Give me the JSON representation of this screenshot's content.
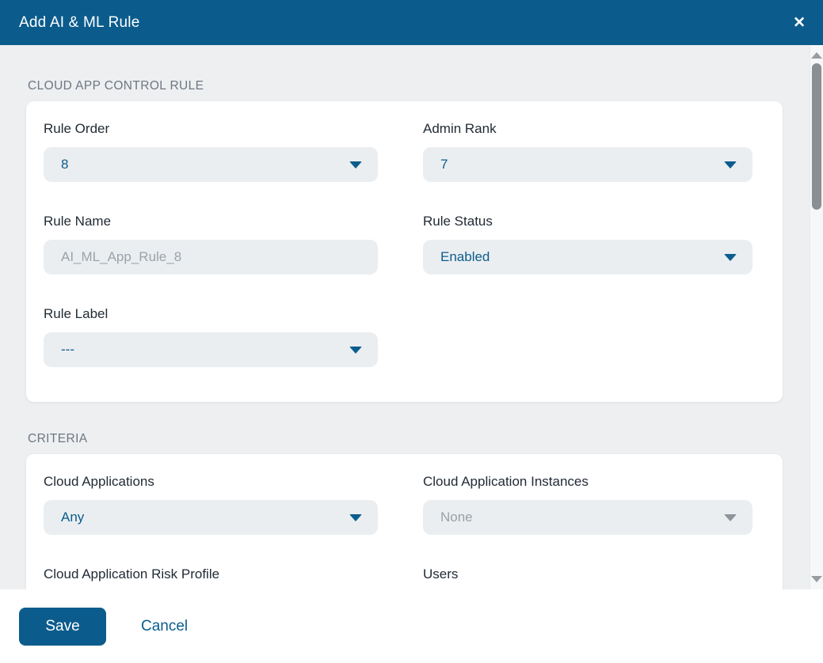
{
  "modal": {
    "title": "Add AI & ML Rule",
    "close_icon": "✕"
  },
  "rule_section": {
    "title": "CLOUD APP CONTROL RULE",
    "fields": {
      "rule_order": {
        "label": "Rule Order",
        "value": "8"
      },
      "admin_rank": {
        "label": "Admin Rank",
        "value": "7"
      },
      "rule_name": {
        "label": "Rule Name",
        "value": "",
        "placeholder": "AI_ML_App_Rule_8"
      },
      "rule_status": {
        "label": "Rule Status",
        "value": "Enabled"
      },
      "rule_label": {
        "label": "Rule Label",
        "value": "---"
      }
    }
  },
  "criteria_section": {
    "title": "CRITERIA",
    "fields": {
      "cloud_applications": {
        "label": "Cloud Applications",
        "value": "Any"
      },
      "cloud_application_instances": {
        "label": "Cloud Application Instances",
        "value": "None",
        "state": "disabled"
      },
      "cloud_application_risk_profile": {
        "label": "Cloud Application Risk Profile",
        "value": ""
      },
      "users": {
        "label": "Users",
        "value": ""
      }
    }
  },
  "footer": {
    "save_label": "Save",
    "cancel_label": "Cancel"
  },
  "colors": {
    "header_bg": "#0b5c8c",
    "accent_text": "#0b5d8e",
    "body_bg": "#edeff1",
    "disabled_text": "#9aa1a9"
  }
}
